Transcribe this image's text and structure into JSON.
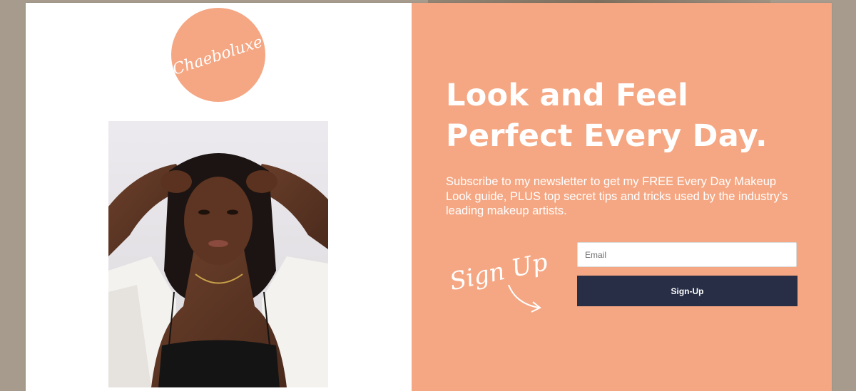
{
  "brand": {
    "logo_text": "Chaeboluxe",
    "logo_color": "#f5a682"
  },
  "hero": {
    "headline_line1": "Look and Feel",
    "headline_line2": "Perfect Every Day.",
    "subtext": "Subscribe to my newsletter to get my FREE Every Day Makeup Look guide, PLUS top secret tips and tricks used by the industry’s leading makeup artists.",
    "accent_color": "#f5a783"
  },
  "signup": {
    "script_label": "Sign Up",
    "email_placeholder": "Email",
    "email_value": "",
    "button_label": "Sign-Up",
    "button_color": "#272e45"
  },
  "photo": {
    "icon": "portrait-photo"
  }
}
